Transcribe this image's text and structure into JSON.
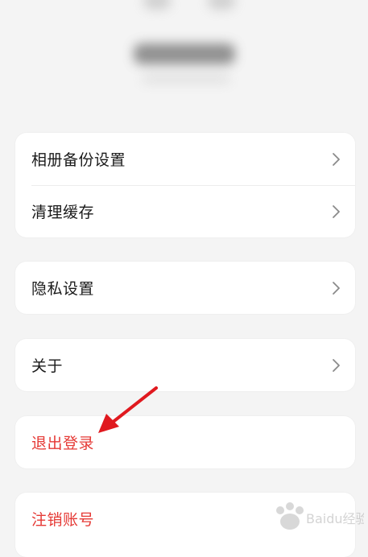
{
  "settings": {
    "group1": [
      {
        "label": "相册备份设置",
        "icon": "chevron-right-icon"
      },
      {
        "label": "清理缓存",
        "icon": "chevron-right-icon"
      }
    ],
    "group2": [
      {
        "label": "隐私设置",
        "icon": "chevron-right-icon"
      }
    ],
    "group3": [
      {
        "label": "关于",
        "icon": "chevron-right-icon"
      }
    ],
    "logout": {
      "label": "退出登录"
    },
    "deregister": {
      "label": "注销账号"
    }
  },
  "colors": {
    "background": "#f4f4f4",
    "card": "#ffffff",
    "text": "#1a1a1a",
    "danger": "#e53935",
    "chevron": "#8a8a8a",
    "annotation": "#e0191f"
  },
  "watermark": {
    "text": "Baidu经验"
  }
}
